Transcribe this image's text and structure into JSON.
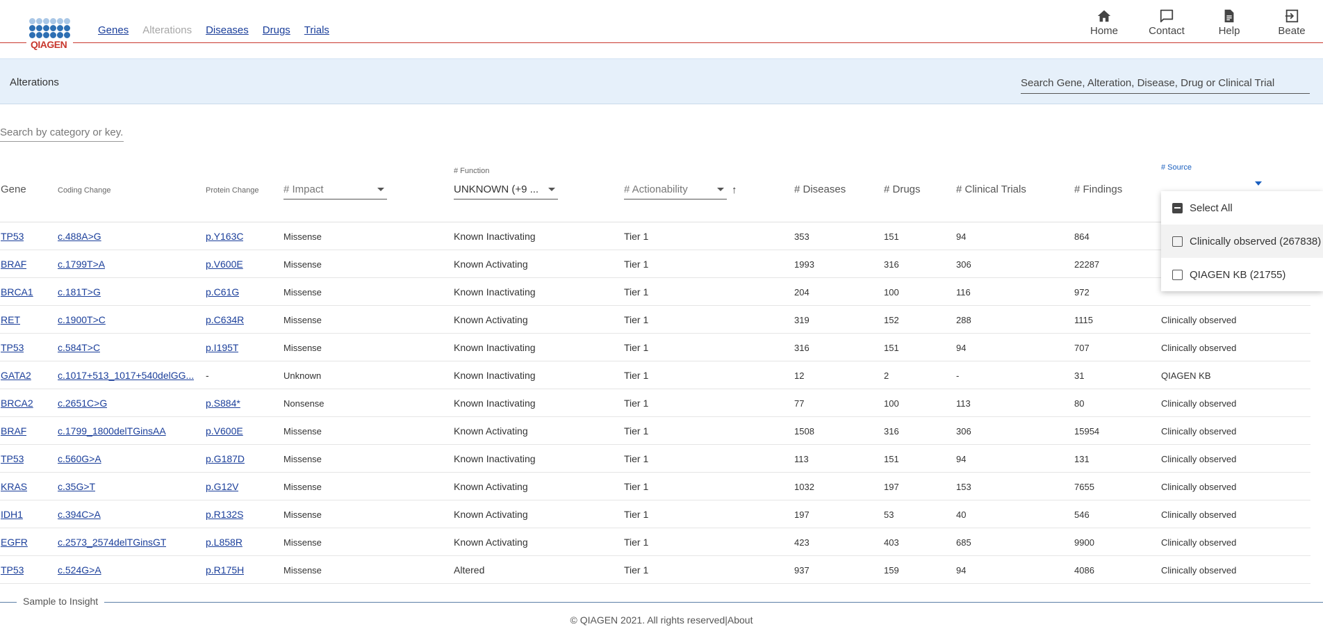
{
  "brand": {
    "logo_text": "QIAGEN",
    "accent": "#c8372d",
    "link_color": "#1a3e9a"
  },
  "nav": {
    "items": [
      {
        "label": "Genes",
        "active": true
      },
      {
        "label": "Alterations",
        "active": false
      },
      {
        "label": "Diseases",
        "active": true
      },
      {
        "label": "Drugs",
        "active": true
      },
      {
        "label": "Trials",
        "active": true
      }
    ]
  },
  "top_links": [
    {
      "label": "Home",
      "icon": "home-icon"
    },
    {
      "label": "Contact",
      "icon": "chat-icon"
    },
    {
      "label": "Help",
      "icon": "document-icon"
    },
    {
      "label": "Beate",
      "icon": "logout-icon"
    }
  ],
  "band": {
    "title": "Alterations",
    "search_placeholder": "Search Gene, Alteration, Disease, Drug or Clinical Trial"
  },
  "category_search_placeholder": "Search by category or key...",
  "headers": {
    "gene": "Gene",
    "coding_change": "Coding Change",
    "protein_change": "Protein Change",
    "impact": "# Impact",
    "function_label": "# Function",
    "function_value": "UNKNOWN (+9 ...",
    "actionability": "# Actionability",
    "diseases": "# Diseases",
    "drugs": "# Drugs",
    "clinical_trials": "# Clinical Trials",
    "findings": "# Findings",
    "source": "# Source"
  },
  "source_dropdown": {
    "options": [
      {
        "label": "Select All",
        "state": "indeterminate"
      },
      {
        "label": "Clinically observed (267838)",
        "state": "unchecked"
      },
      {
        "label": "QIAGEN KB (21755)",
        "state": "unchecked"
      }
    ]
  },
  "rows": [
    {
      "gene": "TP53",
      "coding": "c.488A>G",
      "protein": "p.Y163C",
      "impact": "Missense",
      "function": "Known Inactivating",
      "actionability": "Tier 1",
      "diseases": "353",
      "drugs": "151",
      "trials": "94",
      "findings": "864",
      "source": ""
    },
    {
      "gene": "BRAF",
      "coding": "c.1799T>A",
      "protein": "p.V600E",
      "impact": "Missense",
      "function": "Known Activating",
      "actionability": "Tier 1",
      "diseases": "1993",
      "drugs": "316",
      "trials": "306",
      "findings": "22287",
      "source": ""
    },
    {
      "gene": "BRCA1",
      "coding": "c.181T>G",
      "protein": "p.C61G",
      "impact": "Missense",
      "function": "Known Inactivating",
      "actionability": "Tier 1",
      "diseases": "204",
      "drugs": "100",
      "trials": "116",
      "findings": "972",
      "source": ""
    },
    {
      "gene": "RET",
      "coding": "c.1900T>C",
      "protein": "p.C634R",
      "impact": "Missense",
      "function": "Known Activating",
      "actionability": "Tier 1",
      "diseases": "319",
      "drugs": "152",
      "trials": "288",
      "findings": "1115",
      "source": "Clinically observed"
    },
    {
      "gene": "TP53",
      "coding": "c.584T>C",
      "protein": "p.I195T",
      "impact": "Missense",
      "function": "Known Inactivating",
      "actionability": "Tier 1",
      "diseases": "316",
      "drugs": "151",
      "trials": "94",
      "findings": "707",
      "source": "Clinically observed"
    },
    {
      "gene": "GATA2",
      "coding": "c.1017+513_1017+540delGG...",
      "protein": "-",
      "impact": "Unknown",
      "function": "Known Inactivating",
      "actionability": "Tier 1",
      "diseases": "12",
      "drugs": "2",
      "trials": "-",
      "findings": "31",
      "source": "QIAGEN KB"
    },
    {
      "gene": "BRCA2",
      "coding": "c.2651C>G",
      "protein": "p.S884*",
      "impact": "Nonsense",
      "function": "Known Inactivating",
      "actionability": "Tier 1",
      "diseases": "77",
      "drugs": "100",
      "trials": "113",
      "findings": "80",
      "source": "Clinically observed"
    },
    {
      "gene": "BRAF",
      "coding": "c.1799_1800delTGinsAA",
      "protein": "p.V600E",
      "impact": "Missense",
      "function": "Known Activating",
      "actionability": "Tier 1",
      "diseases": "1508",
      "drugs": "316",
      "trials": "306",
      "findings": "15954",
      "source": "Clinically observed"
    },
    {
      "gene": "TP53",
      "coding": "c.560G>A",
      "protein": "p.G187D",
      "impact": "Missense",
      "function": "Known Inactivating",
      "actionability": "Tier 1",
      "diseases": "113",
      "drugs": "151",
      "trials": "94",
      "findings": "131",
      "source": "Clinically observed"
    },
    {
      "gene": "KRAS",
      "coding": "c.35G>T",
      "protein": "p.G12V",
      "impact": "Missense",
      "function": "Known Activating",
      "actionability": "Tier 1",
      "diseases": "1032",
      "drugs": "197",
      "trials": "153",
      "findings": "7655",
      "source": "Clinically observed"
    },
    {
      "gene": "IDH1",
      "coding": "c.394C>A",
      "protein": "p.R132S",
      "impact": "Missense",
      "function": "Known Activating",
      "actionability": "Tier 1",
      "diseases": "197",
      "drugs": "53",
      "trials": "40",
      "findings": "546",
      "source": "Clinically observed"
    },
    {
      "gene": "EGFR",
      "coding": "c.2573_2574delTGinsGT",
      "protein": "p.L858R",
      "impact": "Missense",
      "function": "Known Activating",
      "actionability": "Tier 1",
      "diseases": "423",
      "drugs": "403",
      "trials": "685",
      "findings": "9900",
      "source": "Clinically observed"
    },
    {
      "gene": "TP53",
      "coding": "c.524G>A",
      "protein": "p.R175H",
      "impact": "Missense",
      "function": "Altered",
      "actionability": "Tier 1",
      "diseases": "937",
      "drugs": "159",
      "trials": "94",
      "findings": "4086",
      "source": "Clinically observed"
    }
  ],
  "footer": {
    "tagline": "Sample to Insight",
    "copyright": "© QIAGEN 2021. All rights reserved",
    "about": "About"
  }
}
